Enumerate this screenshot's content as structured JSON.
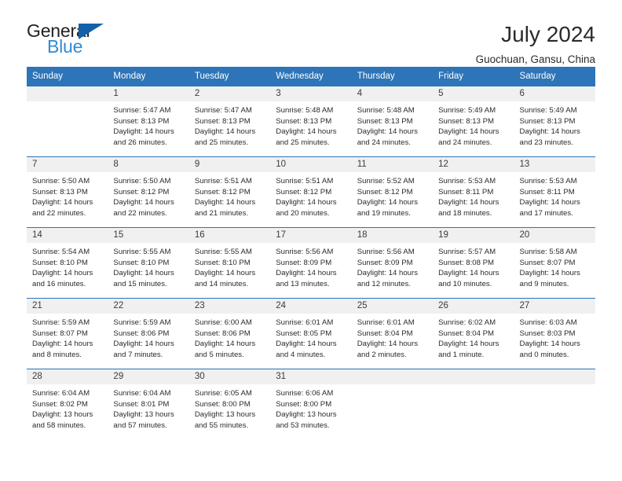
{
  "brand": {
    "name_top": "General",
    "name_bottom": "Blue",
    "triangle_color": "#1561a9",
    "blue_text_color": "#2e8bd6"
  },
  "header": {
    "month_title": "July 2024",
    "location": "Guochuan, Gansu, China"
  },
  "colors": {
    "header_band": "#2d74b8",
    "day_number_band": "#f0f0f0",
    "row_separator": "#9bb7d4",
    "row_separator_accent": "#2d74b8"
  },
  "weekdays": [
    "Sunday",
    "Monday",
    "Tuesday",
    "Wednesday",
    "Thursday",
    "Friday",
    "Saturday"
  ],
  "weeks": [
    {
      "separator": "none",
      "days": [
        {
          "num": "",
          "sunrise": "",
          "sunset": "",
          "daylight1": "",
          "daylight2": "",
          "empty": true
        },
        {
          "num": "1",
          "sunrise": "Sunrise: 5:47 AM",
          "sunset": "Sunset: 8:13 PM",
          "daylight1": "Daylight: 14 hours",
          "daylight2": "and 26 minutes."
        },
        {
          "num": "2",
          "sunrise": "Sunrise: 5:47 AM",
          "sunset": "Sunset: 8:13 PM",
          "daylight1": "Daylight: 14 hours",
          "daylight2": "and 25 minutes."
        },
        {
          "num": "3",
          "sunrise": "Sunrise: 5:48 AM",
          "sunset": "Sunset: 8:13 PM",
          "daylight1": "Daylight: 14 hours",
          "daylight2": "and 25 minutes."
        },
        {
          "num": "4",
          "sunrise": "Sunrise: 5:48 AM",
          "sunset": "Sunset: 8:13 PM",
          "daylight1": "Daylight: 14 hours",
          "daylight2": "and 24 minutes."
        },
        {
          "num": "5",
          "sunrise": "Sunrise: 5:49 AM",
          "sunset": "Sunset: 8:13 PM",
          "daylight1": "Daylight: 14 hours",
          "daylight2": "and 24 minutes."
        },
        {
          "num": "6",
          "sunrise": "Sunrise: 5:49 AM",
          "sunset": "Sunset: 8:13 PM",
          "daylight1": "Daylight: 14 hours",
          "daylight2": "and 23 minutes."
        }
      ]
    },
    {
      "separator": "accent",
      "days": [
        {
          "num": "7",
          "sunrise": "Sunrise: 5:50 AM",
          "sunset": "Sunset: 8:13 PM",
          "daylight1": "Daylight: 14 hours",
          "daylight2": "and 22 minutes."
        },
        {
          "num": "8",
          "sunrise": "Sunrise: 5:50 AM",
          "sunset": "Sunset: 8:12 PM",
          "daylight1": "Daylight: 14 hours",
          "daylight2": "and 22 minutes."
        },
        {
          "num": "9",
          "sunrise": "Sunrise: 5:51 AM",
          "sunset": "Sunset: 8:12 PM",
          "daylight1": "Daylight: 14 hours",
          "daylight2": "and 21 minutes."
        },
        {
          "num": "10",
          "sunrise": "Sunrise: 5:51 AM",
          "sunset": "Sunset: 8:12 PM",
          "daylight1": "Daylight: 14 hours",
          "daylight2": "and 20 minutes."
        },
        {
          "num": "11",
          "sunrise": "Sunrise: 5:52 AM",
          "sunset": "Sunset: 8:12 PM",
          "daylight1": "Daylight: 14 hours",
          "daylight2": "and 19 minutes."
        },
        {
          "num": "12",
          "sunrise": "Sunrise: 5:53 AM",
          "sunset": "Sunset: 8:11 PM",
          "daylight1": "Daylight: 14 hours",
          "daylight2": "and 18 minutes."
        },
        {
          "num": "13",
          "sunrise": "Sunrise: 5:53 AM",
          "sunset": "Sunset: 8:11 PM",
          "daylight1": "Daylight: 14 hours",
          "daylight2": "and 17 minutes."
        }
      ]
    },
    {
      "separator": "accent",
      "days": [
        {
          "num": "14",
          "sunrise": "Sunrise: 5:54 AM",
          "sunset": "Sunset: 8:10 PM",
          "daylight1": "Daylight: 14 hours",
          "daylight2": "and 16 minutes."
        },
        {
          "num": "15",
          "sunrise": "Sunrise: 5:55 AM",
          "sunset": "Sunset: 8:10 PM",
          "daylight1": "Daylight: 14 hours",
          "daylight2": "and 15 minutes."
        },
        {
          "num": "16",
          "sunrise": "Sunrise: 5:55 AM",
          "sunset": "Sunset: 8:10 PM",
          "daylight1": "Daylight: 14 hours",
          "daylight2": "and 14 minutes."
        },
        {
          "num": "17",
          "sunrise": "Sunrise: 5:56 AM",
          "sunset": "Sunset: 8:09 PM",
          "daylight1": "Daylight: 14 hours",
          "daylight2": "and 13 minutes."
        },
        {
          "num": "18",
          "sunrise": "Sunrise: 5:56 AM",
          "sunset": "Sunset: 8:09 PM",
          "daylight1": "Daylight: 14 hours",
          "daylight2": "and 12 minutes."
        },
        {
          "num": "19",
          "sunrise": "Sunrise: 5:57 AM",
          "sunset": "Sunset: 8:08 PM",
          "daylight1": "Daylight: 14 hours",
          "daylight2": "and 10 minutes."
        },
        {
          "num": "20",
          "sunrise": "Sunrise: 5:58 AM",
          "sunset": "Sunset: 8:07 PM",
          "daylight1": "Daylight: 14 hours",
          "daylight2": "and 9 minutes."
        }
      ]
    },
    {
      "separator": "accent",
      "days": [
        {
          "num": "21",
          "sunrise": "Sunrise: 5:59 AM",
          "sunset": "Sunset: 8:07 PM",
          "daylight1": "Daylight: 14 hours",
          "daylight2": "and 8 minutes."
        },
        {
          "num": "22",
          "sunrise": "Sunrise: 5:59 AM",
          "sunset": "Sunset: 8:06 PM",
          "daylight1": "Daylight: 14 hours",
          "daylight2": "and 7 minutes."
        },
        {
          "num": "23",
          "sunrise": "Sunrise: 6:00 AM",
          "sunset": "Sunset: 8:06 PM",
          "daylight1": "Daylight: 14 hours",
          "daylight2": "and 5 minutes."
        },
        {
          "num": "24",
          "sunrise": "Sunrise: 6:01 AM",
          "sunset": "Sunset: 8:05 PM",
          "daylight1": "Daylight: 14 hours",
          "daylight2": "and 4 minutes."
        },
        {
          "num": "25",
          "sunrise": "Sunrise: 6:01 AM",
          "sunset": "Sunset: 8:04 PM",
          "daylight1": "Daylight: 14 hours",
          "daylight2": "and 2 minutes."
        },
        {
          "num": "26",
          "sunrise": "Sunrise: 6:02 AM",
          "sunset": "Sunset: 8:04 PM",
          "daylight1": "Daylight: 14 hours",
          "daylight2": "and 1 minute."
        },
        {
          "num": "27",
          "sunrise": "Sunrise: 6:03 AM",
          "sunset": "Sunset: 8:03 PM",
          "daylight1": "Daylight: 14 hours",
          "daylight2": "and 0 minutes."
        }
      ]
    },
    {
      "separator": "accent",
      "days": [
        {
          "num": "28",
          "sunrise": "Sunrise: 6:04 AM",
          "sunset": "Sunset: 8:02 PM",
          "daylight1": "Daylight: 13 hours",
          "daylight2": "and 58 minutes."
        },
        {
          "num": "29",
          "sunrise": "Sunrise: 6:04 AM",
          "sunset": "Sunset: 8:01 PM",
          "daylight1": "Daylight: 13 hours",
          "daylight2": "and 57 minutes."
        },
        {
          "num": "30",
          "sunrise": "Sunrise: 6:05 AM",
          "sunset": "Sunset: 8:00 PM",
          "daylight1": "Daylight: 13 hours",
          "daylight2": "and 55 minutes."
        },
        {
          "num": "31",
          "sunrise": "Sunrise: 6:06 AM",
          "sunset": "Sunset: 8:00 PM",
          "daylight1": "Daylight: 13 hours",
          "daylight2": "and 53 minutes."
        },
        {
          "num": "",
          "sunrise": "",
          "sunset": "",
          "daylight1": "",
          "daylight2": "",
          "empty": true
        },
        {
          "num": "",
          "sunrise": "",
          "sunset": "",
          "daylight1": "",
          "daylight2": "",
          "empty": true
        },
        {
          "num": "",
          "sunrise": "",
          "sunset": "",
          "daylight1": "",
          "daylight2": "",
          "empty": true
        }
      ]
    }
  ]
}
